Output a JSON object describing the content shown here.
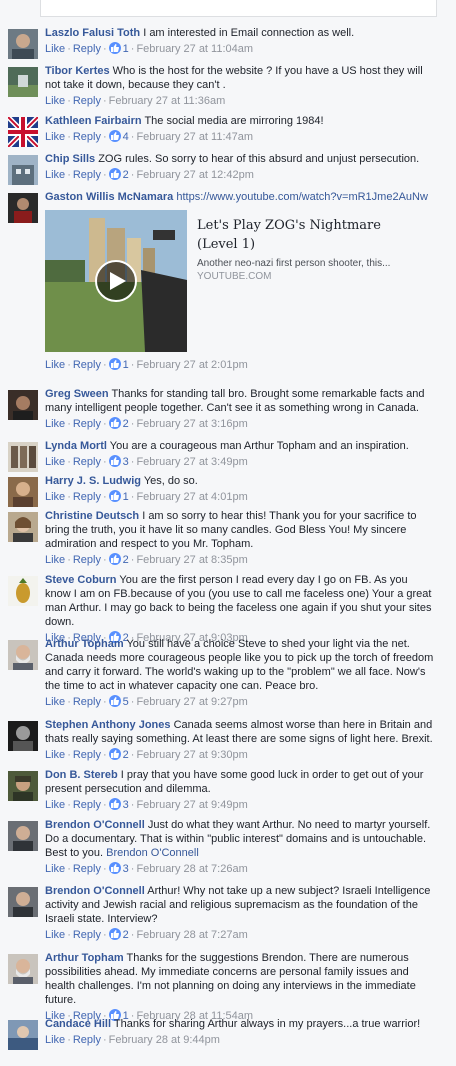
{
  "ui": {
    "like": "Like",
    "reply": "Reply",
    "dot": "·"
  },
  "comments": [
    {
      "author": "Laszlo Falusi Toth",
      "text": "I am interested in Email connection as well.",
      "likes": "1",
      "time": "February 27 at 11:04am"
    },
    {
      "author": "Tibor Kertes",
      "text": "Who is the host for the website ? If you have a US host they will not take it down, because they can't .",
      "likes": "",
      "time": "February 27 at 11:36am"
    },
    {
      "author": "Kathleen Fairbairn",
      "text": "The social media are mirroring 1984!",
      "likes": "4",
      "time": "February 27 at 11:47am"
    },
    {
      "author": "Chip Sills",
      "text": "ZOG rules. So sorry to hear of this absurd and unjust persecution.",
      "likes": "2",
      "time": "February 27 at 12:42pm"
    },
    {
      "author": "Gaston Willis McNamara",
      "text": "https://www.youtube.com/watch?v=mR1Jme2AuNw",
      "likes": "1",
      "time": "February 27 at 2:01pm",
      "link": {
        "title": "Let's Play ZOG's Nightmare (Level 1)",
        "description": "Another neo-nazi first person shooter, this...",
        "domain": "YOUTUBE.COM"
      }
    },
    {
      "author": "Greg Sween",
      "text": "Thanks for standing tall bro. Brought some remarkable facts and many intelligent people together. Can't see it as something wrong in Canada.",
      "likes": "2",
      "time": "February 27 at 3:16pm"
    },
    {
      "author": "Lynda Mortl",
      "text": "You are a courageous man Arthur Topham and an inspiration.",
      "likes": "3",
      "time": "February 27 at 3:49pm"
    },
    {
      "author": "Harry J. S. Ludwig",
      "text": "Yes, do so.",
      "likes": "1",
      "time": "February 27 at 4:01pm"
    },
    {
      "author": "Christine Deutsch",
      "text": "I am so sorry to hear this! Thank you for your sacrifice to bring the truth, you it have lit so many candles. God Bless You! My sincere admiration and respect to you Mr. Topham.",
      "likes": "2",
      "time": "February 27 at 8:35pm"
    },
    {
      "author": "Steve Coburn",
      "text": "You are the first person I read every day I go on FB. As you know I am on FB.because of you (you use to call me faceless one) Your a great man Arthur. I may go back to being the faceless one again if you shut your sites down.",
      "likes": "2",
      "time": "February 27 at 9:03pm"
    },
    {
      "author": "Arthur Topham",
      "text": "You still have a choice Steve to shed your light via the net. Canada needs more courageous people like you to pick up the torch of freedom and carry it forward. The world's waking up to the \"problem\" we all face. Now's the time to act in whatever capacity one can. Peace bro.",
      "likes": "5",
      "time": "February 27 at 9:27pm"
    },
    {
      "author": "Stephen Anthony Jones",
      "text": "Canada seems almost worse than here in Britain and thats really saying something. At least there are some signs of light here. Brexit.",
      "likes": "2",
      "time": "February 27 at 9:30pm"
    },
    {
      "author": "Don B. Stereb",
      "text": "I pray that you have some good luck in order to get out of your present persecution and dilemma.",
      "likes": "3",
      "time": "February 27 at 9:49pm"
    },
    {
      "author": "Brendon O'Connell",
      "text": "Just do what they want Arthur. No need to martyr yourself. Do a documentary. That is within \"public interest\" domains and is untouchable. Best to you.",
      "mention": "Brendon O'Connell",
      "likes": "3",
      "time": "February 28 at 7:26am"
    },
    {
      "author": "Brendon O'Connell",
      "text": "Arthur! Why not take up a new subject? Israeli Intelligence activity and Jewish racial and religious supremacism as the foundation of the Israeli state. Interview?",
      "likes": "2",
      "time": "February 28 at 7:27am"
    },
    {
      "author": "Arthur Topham",
      "text": "Thanks for the suggestions Brendon. There are numerous possibilities ahead. My immediate concerns are personal family issues and health challenges. I'm not planning on doing any interviews in the immediate future.",
      "likes": "1",
      "time": "February 28 at 11:54am"
    },
    {
      "author": "Candace Hill",
      "text": "Thanks for sharing Arthur always in my prayers...a true warrior!",
      "likes": "",
      "time": "February 28 at 9:44pm"
    }
  ]
}
